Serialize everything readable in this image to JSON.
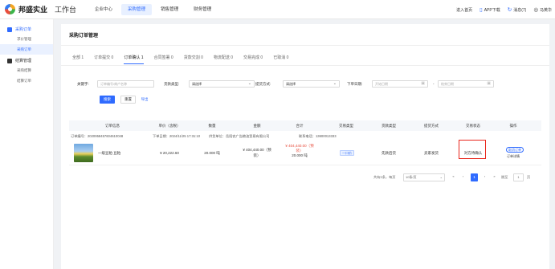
{
  "brand": {
    "name": "邦盛实业",
    "workbench": "工作台"
  },
  "top_nav": [
    "企业中心",
    "采购管理",
    "销售管理",
    "财务管理"
  ],
  "top_right": {
    "home": "进入首页",
    "app": "APP下载",
    "messages": "消息(7)",
    "user": "马英华"
  },
  "sidebar": {
    "group1": {
      "title": "采购订单",
      "items": [
        "求价管理",
        "采购订单"
      ]
    },
    "group2": {
      "title": "结算管理",
      "items": [
        "采购结算",
        "结算订单"
      ]
    }
  },
  "main": {
    "title": "采购订单管理",
    "tabs": [
      "全部 1",
      "订单提交 0",
      "订单确认 1",
      "合同签署 0",
      "货款交割 0",
      "物流配送 0",
      "交易完成 0",
      "已取消 0"
    ],
    "filters": {
      "keyword_label": "关键字:",
      "keyword_placeholder": "订单编号/商户名称",
      "payment_label": "货款类型:",
      "payment_value": "请选择",
      "pickup_label": "提货方式:",
      "pickup_value": "请选择",
      "date_label": "下单日期:",
      "start_placeholder": "开始日期",
      "separator": "-",
      "end_placeholder": "结束日期",
      "search": "搜索",
      "reset": "重置",
      "export": "导出"
    },
    "table": {
      "headers": [
        "订单信息",
        "单价（含税）",
        "数量",
        "金额",
        "合计",
        "交易类型",
        "货款类型",
        "提货方式",
        "交易状态",
        "操作"
      ],
      "order_no": "订单编号：2020958457604610048",
      "order_date": "下单日期：2024/11/25 17:31:10",
      "supplier": "供货单位：岳阳农广告粮油贸易有限公司",
      "contact": "联系电话：13600013333",
      "row": {
        "product": "一级豆粕 豆粕",
        "price": "¥ 20,222.60",
        "qty": "20.000 吨",
        "amount_line1": "¥ 404,440.00（预",
        "amount_line2": "装）",
        "total_line1": "¥ 404,440.00（预",
        "total_line2": "装）",
        "total_qty": "20.000 吨",
        "trade_type": "一口价",
        "payment_type": "先款后货",
        "pickup": "卖家发货",
        "status": "对方待确认",
        "cancel": "取消订单",
        "detail": "订单详情"
      }
    },
    "pagination": {
      "total": "共有1条，每页",
      "page_size": "10条/页",
      "first": "«",
      "prev": "‹",
      "current": "1",
      "next": "›",
      "last": "»",
      "jump_label": "跳至",
      "jump_value": "1",
      "page_suffix": "页"
    }
  },
  "colors": {
    "accent": "#2f6bff",
    "danger": "#e74c3c",
    "highlight_box": "#e8261c"
  }
}
